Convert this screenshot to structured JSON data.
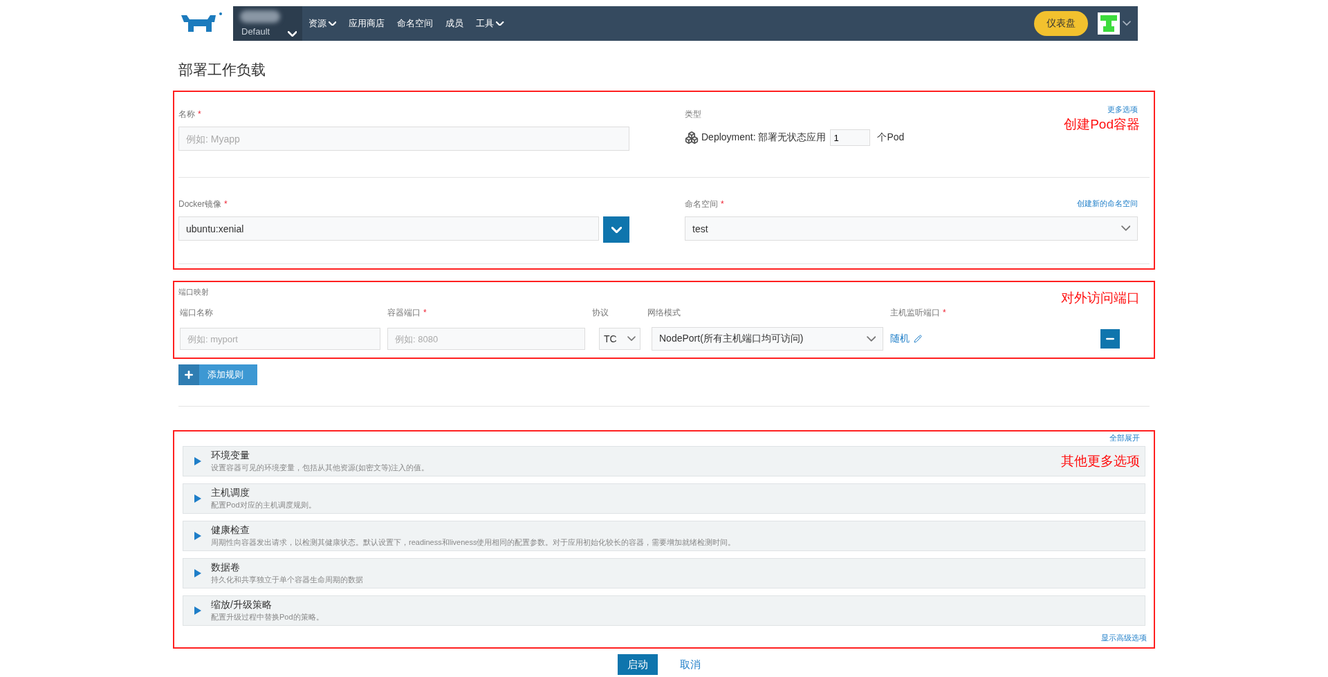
{
  "nav": {
    "environment": "Default",
    "menu": [
      {
        "label": "资源",
        "dropdown": true
      },
      {
        "label": "应用商店",
        "dropdown": false
      },
      {
        "label": "命名空间",
        "dropdown": false
      },
      {
        "label": "成员",
        "dropdown": false
      },
      {
        "label": "工具",
        "dropdown": true
      }
    ],
    "dashboard_button": "仪表盘"
  },
  "title": "部署工作负载",
  "basic": {
    "annotation": "创建Pod容器",
    "more_options": "更多选项",
    "name": {
      "label": "名称",
      "mark": "*",
      "placeholder": "例如: Myapp"
    },
    "type": {
      "label": "类型",
      "text": "Deployment: 部署无状态应用",
      "count": "1",
      "unit": "个Pod"
    },
    "image": {
      "label": "Docker镜像",
      "mark": "*",
      "value": "ubuntu:xenial"
    },
    "namespace": {
      "label": "命名空间",
      "mark": "*",
      "value": "test",
      "link": "创建新的命名空间"
    }
  },
  "ports": {
    "annotation": "对外访问端口",
    "title": "端口映射",
    "columns": [
      {
        "label": "端口名称"
      },
      {
        "label": "容器端口",
        "mark": "*"
      },
      {
        "label": "协议"
      },
      {
        "label": "网络模式"
      },
      {
        "label": "主机监听端口",
        "mark": "*"
      }
    ],
    "rows": [
      {
        "name_placeholder": "例如: myport",
        "port_placeholder": "例如: 8080",
        "protocol": "TC",
        "network_mode": "NodePort(所有主机端口均可访问)",
        "host_port": "随机"
      }
    ],
    "add_button": "添加规则"
  },
  "options": {
    "annotation": "其他更多选项",
    "expand_all": "全部展开",
    "items": [
      {
        "title": "环境变量",
        "description": "设置容器可见的环境变量，包括从其他资源(如密文等)注入的值。",
        "expanded": false
      },
      {
        "title": "主机调度",
        "description": "配置Pod对应的主机调度规则。",
        "expanded": false
      },
      {
        "title": "健康检查",
        "description": "周期性向容器发出请求，以检测其健康状态。默认设置下，readiness和liveness使用相同的配置参数。对于应用初始化较长的容器，需要增加就绪检测时间。",
        "expanded": false
      },
      {
        "title": "数据卷",
        "description": "持久化和共享独立于单个容器生命周期的数据",
        "expanded": false
      },
      {
        "title": "缩放/升级策略",
        "description": "配置升级过程中替换Pod的策略。",
        "expanded": false
      }
    ],
    "advanced": "显示高级选项"
  },
  "actions": [
    {
      "label": "启动",
      "kind": "primary"
    },
    {
      "label": "取消",
      "kind": "link"
    }
  ]
}
